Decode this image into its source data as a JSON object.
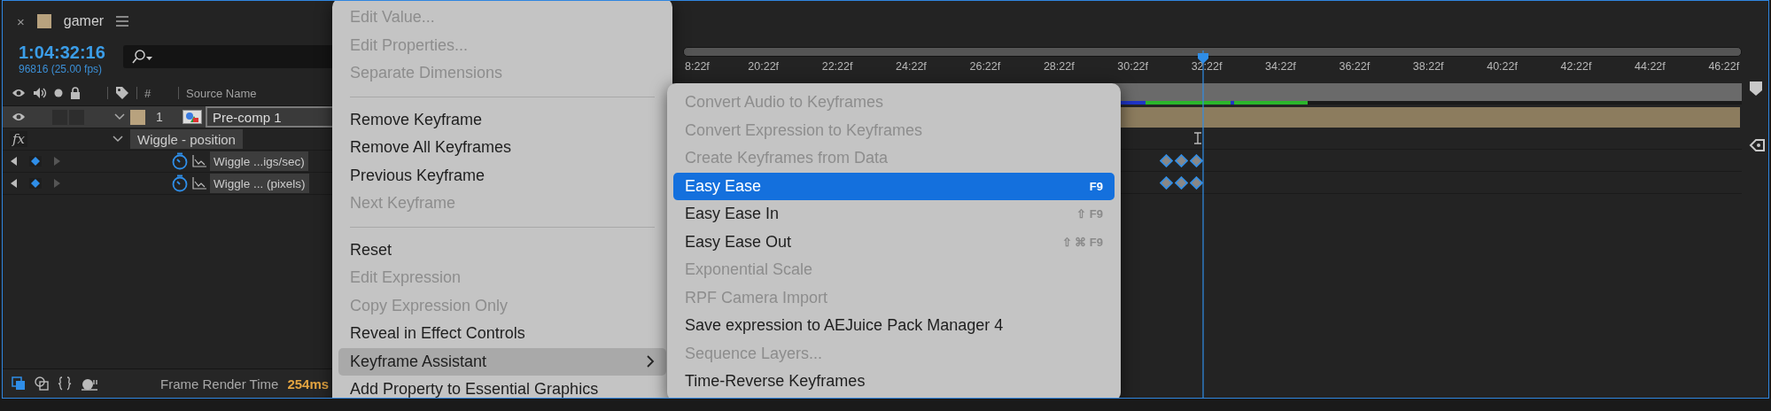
{
  "panel": {
    "close": "×",
    "title": "gamer",
    "color": "#b8a27e"
  },
  "timecode": "1:04:32:16",
  "frame_info": "96816 (25.00 fps)",
  "columns": [
    "#",
    "Source Name"
  ],
  "layers": [
    {
      "number": "1",
      "name": "Pre-comp 1",
      "color": "#b8a27e",
      "selected": true,
      "expanded": true,
      "effects": [
        {
          "badge": "fx",
          "name": "Wiggle - position",
          "expanded": true,
          "properties": [
            {
              "name": "Wiggle ...igs/sec)"
            },
            {
              "name": "Wiggle ... (pixels)"
            }
          ]
        }
      ]
    }
  ],
  "timeline": {
    "ruler_labels": [
      "8:22f",
      "20:22f",
      "22:22f",
      "24:22f",
      "26:22f",
      "28:22f",
      "30:22f",
      "32:22f",
      "34:22f",
      "36:22f",
      "38:22f",
      "40:22f",
      "42:22f",
      "44:22f",
      "46:22f"
    ]
  },
  "context_menu": {
    "items": [
      {
        "kind": "item",
        "label": "Edit Value...",
        "disabled": true,
        "selected": false
      },
      {
        "kind": "item",
        "label": "Edit Properties...",
        "disabled": true,
        "selected": false
      },
      {
        "kind": "item",
        "label": "Separate Dimensions",
        "disabled": true,
        "selected": false
      },
      {
        "kind": "separator"
      },
      {
        "kind": "item",
        "label": "Remove Keyframe",
        "disabled": false,
        "selected": false
      },
      {
        "kind": "item",
        "label": "Remove All Keyframes",
        "disabled": false,
        "selected": false
      },
      {
        "kind": "item",
        "label": "Previous Keyframe",
        "disabled": false,
        "selected": false
      },
      {
        "kind": "item",
        "label": "Next Keyframe",
        "disabled": true,
        "selected": false
      },
      {
        "kind": "separator"
      },
      {
        "kind": "item",
        "label": "Reset",
        "disabled": false,
        "selected": false
      },
      {
        "kind": "item",
        "label": "Edit Expression",
        "disabled": true,
        "selected": false
      },
      {
        "kind": "item",
        "label": "Copy Expression Only",
        "disabled": true,
        "selected": false
      },
      {
        "kind": "item",
        "label": "Reveal in Effect Controls",
        "disabled": false,
        "selected": false
      },
      {
        "kind": "submenu",
        "label": "Keyframe Assistant",
        "disabled": false,
        "selected": true
      },
      {
        "kind": "item",
        "label": "Add Property to Essential Graphics",
        "disabled": false,
        "selected": false
      }
    ]
  },
  "submenu": {
    "items": [
      {
        "label": "Convert Audio to Keyframes",
        "disabled": true,
        "selected": false
      },
      {
        "label": "Convert Expression to Keyframes",
        "disabled": true,
        "selected": false
      },
      {
        "label": "Create Keyframes from Data",
        "disabled": true,
        "selected": false
      },
      {
        "label": "Easy Ease",
        "disabled": false,
        "selected": true,
        "shortcut": "F9"
      },
      {
        "label": "Easy Ease In",
        "disabled": false,
        "selected": false,
        "shortcut": "⇧ F9"
      },
      {
        "label": "Easy Ease Out",
        "disabled": false,
        "selected": false,
        "shortcut": "⇧ ⌘ F9"
      },
      {
        "label": "Exponential Scale",
        "disabled": true,
        "selected": false
      },
      {
        "label": "RPF Camera Import",
        "disabled": true,
        "selected": false
      },
      {
        "label": "Save expression to AEJuice Pack Manager 4",
        "disabled": false,
        "selected": false
      },
      {
        "label": "Sequence Layers...",
        "disabled": true,
        "selected": false
      },
      {
        "label": "Time-Reverse Keyframes",
        "disabled": false,
        "selected": false
      }
    ]
  },
  "status_bar": {
    "label": "Frame Render Time",
    "value": "254ms"
  }
}
